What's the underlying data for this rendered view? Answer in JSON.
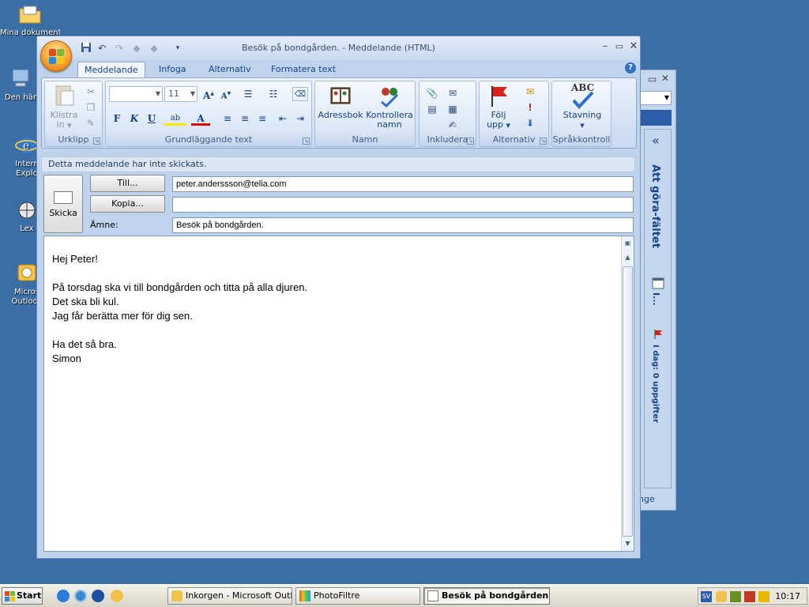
{
  "desktop": {
    "icons": [
      {
        "label": "Mina dokument"
      },
      {
        "label": "Den här"
      },
      {
        "label": "Intern Explo"
      },
      {
        "label": "Lex"
      },
      {
        "label": "Micros Outlook"
      }
    ]
  },
  "window": {
    "title": "Besök på bondgården. - Meddelande (HTML)"
  },
  "ribbon": {
    "tabs": [
      {
        "label": "Meddelande"
      },
      {
        "label": "Infoga"
      },
      {
        "label": "Alternativ"
      },
      {
        "label": "Formatera text"
      }
    ],
    "groups": {
      "urklipp": {
        "label": "Urklipp",
        "paste_label": "Klistra",
        "paste_label2": "in"
      },
      "grundlaggande": {
        "label": "Grundläggande text",
        "font_size": "11",
        "bold": "F",
        "italic": "K",
        "underline": "U"
      },
      "namn": {
        "label": "Namn",
        "adressbok": "Adressbok",
        "kontrollera1": "Kontrollera",
        "kontrollera2": "namn"
      },
      "inkludera": {
        "label": "Inkludera"
      },
      "alternativ": {
        "label": "Alternativ",
        "folj1": "Följ",
        "folj2": "upp"
      },
      "sprakkontroll": {
        "label": "Språkkontroll",
        "stavning": "Stavning",
        "abc": "ABC"
      }
    }
  },
  "infobar": {
    "text": "Detta meddelande har inte skickats."
  },
  "header": {
    "send_label": "Skicka",
    "to_button": "Till...",
    "cc_button": "Kopia...",
    "subject_label": "Ämne:",
    "to_value": "peter.anderssson@telia.com",
    "cc_value": "",
    "subject_value": "Besök på bondgården."
  },
  "body": {
    "lines": [
      "Hej Peter!",
      "",
      "På torsdag ska vi till bondgården och titta på alla djuren.",
      "Det ska bli kul.",
      "Jag får berätta mer för dig sen.",
      "",
      "Ha det så bra.",
      "Simon"
    ]
  },
  "todo_bar": {
    "title": "Att göra-fältet",
    "calendar_label": "I...",
    "tasks_label": "I dag: 0 uppgifter",
    "collapse": "«"
  },
  "background_window": {
    "fragment": "nge"
  },
  "taskbar": {
    "start_label": "Start",
    "buttons": [
      {
        "label": "Inkorgen - Microsoft Outl..."
      },
      {
        "label": "PhotoFiltre"
      },
      {
        "label": "Besök på bondgården..."
      }
    ],
    "clock": "10:17",
    "tray_sv": "SV"
  },
  "colors": {
    "desktop": "#3a6ea5",
    "ribbon_text": "#15428b",
    "accent_orange": "#f9a230"
  }
}
